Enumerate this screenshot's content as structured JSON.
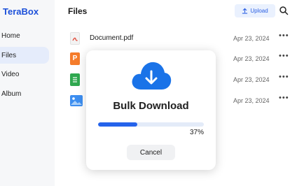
{
  "app": {
    "name": "TeraBox",
    "brand_color": "#1b4fd9"
  },
  "sidebar": {
    "items": [
      {
        "label": "Home",
        "active": false
      },
      {
        "label": "Files",
        "active": true
      },
      {
        "label": "Video",
        "active": false
      },
      {
        "label": "Album",
        "active": false
      }
    ]
  },
  "header": {
    "title": "Files",
    "upload_label": "Upload",
    "upload_icon": "upload-icon",
    "search_icon": "search-icon"
  },
  "files": [
    {
      "name": "Document.pdf",
      "date": "Apr 23, 2024",
      "icon": "pdf-icon",
      "color": "#e04b3a"
    },
    {
      "name": "",
      "date": "Apr 23, 2024",
      "icon": "ppt-icon",
      "color": "#f57c2b"
    },
    {
      "name": "",
      "date": "Apr 23, 2024",
      "icon": "sheet-icon",
      "color": "#2fa84f"
    },
    {
      "name": "",
      "date": "Apr 23, 2024",
      "icon": "image-icon",
      "color": "#3d8ef0"
    }
  ],
  "modal": {
    "title": "Bulk Download",
    "progress": 0.37,
    "progress_text": "37%",
    "cancel_label": "Cancel",
    "icon": "cloud-download-icon",
    "accent": "#2563eb"
  }
}
